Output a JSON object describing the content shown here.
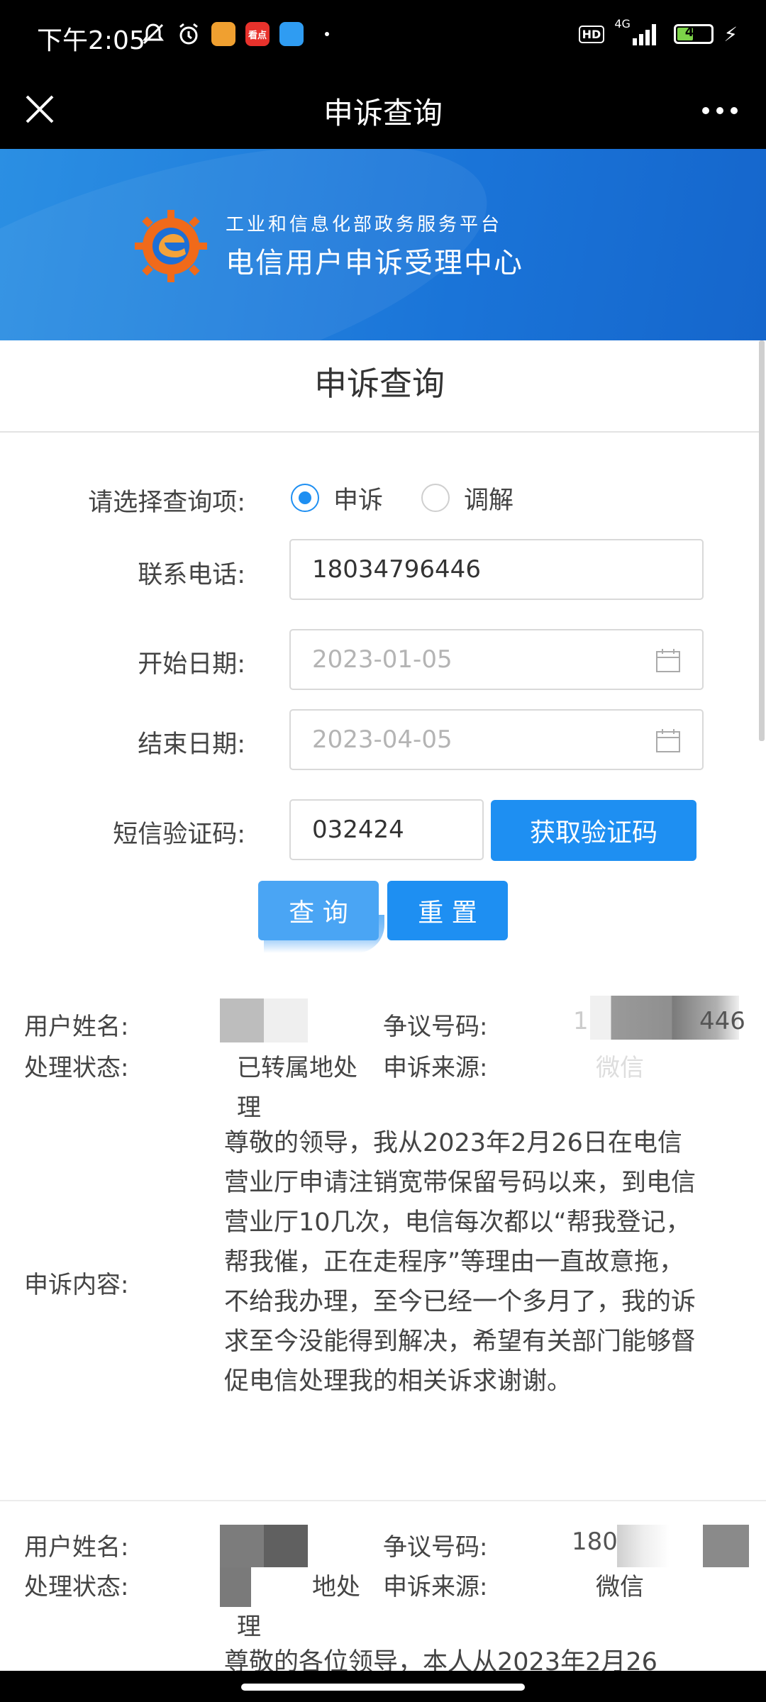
{
  "status_bar": {
    "time": "下午2:05",
    "network": "4G",
    "battery": "44",
    "hd": "HD",
    "app_badge": "看点"
  },
  "title_bar": {
    "title": "申诉查询"
  },
  "banner": {
    "subtitle": "工业和信息化部政务服务平台",
    "title": "电信用户申诉受理中心"
  },
  "page_title": "申诉查询",
  "form": {
    "query_type_label": "请选择查询项:",
    "option_complaint": "申诉",
    "option_mediation": "调解",
    "phone_label": "联系电话:",
    "phone_value": "18034796446",
    "start_label": "开始日期:",
    "start_placeholder": "2023-01-05",
    "end_label": "结束日期:",
    "end_placeholder": "2023-04-05",
    "sms_label": "短信验证码:",
    "sms_value": "032424",
    "get_code_button": "获取验证码",
    "query_button": "查 询",
    "reset_button": "重 置"
  },
  "results": [
    {
      "name_label": "用户姓名:",
      "dispute_label": "争议号码:",
      "dispute_visible": "1",
      "dispute_visible_tail": "446",
      "status_label": "处理状态:",
      "status_value_line1": "已转属地处",
      "status_value_line2": "理",
      "source_label": "申诉来源:",
      "source_value": "微信",
      "content_label": "申诉内容:",
      "content": "尊敬的领导，我从2023年2月26日在电信营业厅申请注销宽带保留号码以来，到电信营业厅10几次，电信每次都以“帮我登记，帮我催，正在走程序”等理由一直故意拖，不给我办理，至今已经一个多月了，我的诉求至今没能得到解决，希望有关部门能够督促电信处理我的相关诉求谢谢。"
    },
    {
      "name_label": "用户姓名:",
      "dispute_label": "争议号码:",
      "dispute_visible": "1803",
      "status_label": "处理状态:",
      "status_value_line1": "地处",
      "status_value_line2": "理",
      "source_label": "申诉来源:",
      "source_value": "微信",
      "content": "尊敬的各位领导，本人从2023年2月26"
    }
  ]
}
